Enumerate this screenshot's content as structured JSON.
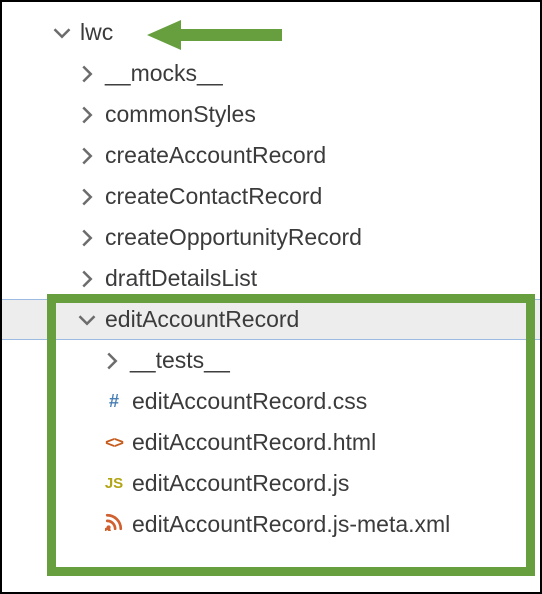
{
  "tree": {
    "root": {
      "label": "lwc"
    },
    "level1": [
      {
        "label": "__mocks__"
      },
      {
        "label": "commonStyles"
      },
      {
        "label": "createAccountRecord"
      },
      {
        "label": "createContactRecord"
      },
      {
        "label": "createOpportunityRecord"
      },
      {
        "label": "draftDetailsList"
      }
    ],
    "selected": {
      "label": "editAccountRecord"
    },
    "children": {
      "folder": {
        "label": "__tests__"
      },
      "files": [
        {
          "icon": "#",
          "iconClass": "ic-css",
          "label": "editAccountRecord.css"
        },
        {
          "icon": "<>",
          "iconClass": "ic-html",
          "label": "editAccountRecord.html"
        },
        {
          "icon": "JS",
          "iconClass": "ic-js",
          "label": "editAccountRecord.js"
        },
        {
          "icon": "",
          "iconClass": "ic-xml",
          "label": "editAccountRecord.js-meta.xml",
          "rss": true
        }
      ]
    }
  },
  "annotations": {
    "arrowColor": "#679f3e",
    "boxColor": "#679f3e"
  }
}
